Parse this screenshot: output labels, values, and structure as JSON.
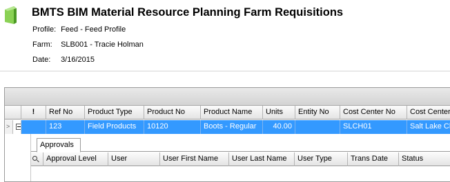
{
  "header": {
    "title": "BMTS BIM Material Resource Planning Farm Requisitions",
    "rows": [
      {
        "label": "Profile:",
        "value": "Feed - Feed Profile"
      },
      {
        "label": "Farm:",
        "value": "SLB001 - Tracie Holman"
      },
      {
        "label": "Date:",
        "value": "3/16/2015"
      }
    ]
  },
  "grid": {
    "columns": [
      "!",
      "Ref No",
      "Product Type",
      "Product No",
      "Product Name",
      "Units",
      "Entity No",
      "Cost Center No",
      "Cost Center"
    ],
    "row": {
      "indicator": ">",
      "ref_no": "123",
      "product_type": "Field Products",
      "product_no": "10120",
      "product_name": "Boots - Regular",
      "units": "40.00",
      "entity_no": "",
      "cost_center_no": "SLCH01",
      "cost_center": "Salt Lake Chic"
    }
  },
  "child": {
    "tab_label": "Approvals",
    "search_icon": "search-icon",
    "columns": [
      "Approval Level",
      "User",
      "User First Name",
      "User Last Name",
      "User Type",
      "Trans Date",
      "Status"
    ]
  },
  "colors": {
    "selection": "#3399ff",
    "logo": "#6cbf3a"
  }
}
